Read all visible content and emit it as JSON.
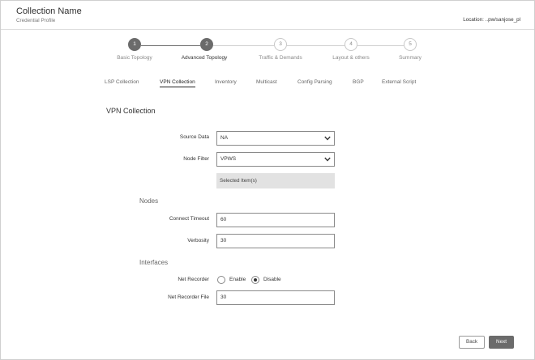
{
  "header": {
    "title": "Collection Name",
    "subtitle": "Credential Profile",
    "location": "Location: ..pw/sanjose_pl"
  },
  "steps": [
    {
      "number": "1",
      "label": "Basic Topology",
      "state": "done"
    },
    {
      "number": "2",
      "label": "Advanced Topology",
      "state": "active"
    },
    {
      "number": "3",
      "label": "Traffic & Demands",
      "state": "todo"
    },
    {
      "number": "4",
      "label": "Layout & others",
      "state": "todo"
    },
    {
      "number": "5",
      "label": "Summary",
      "state": "todo"
    }
  ],
  "tabs": [
    {
      "label": "LSP Collection",
      "active": false
    },
    {
      "label": "VPN Collection",
      "active": true
    },
    {
      "label": "Inventory",
      "active": false
    },
    {
      "label": "Multicast",
      "active": false
    },
    {
      "label": "Config Parsing",
      "active": false
    },
    {
      "label": "BGP",
      "active": false
    },
    {
      "label": "External Script",
      "active": false
    }
  ],
  "form": {
    "section_title": "VPN Collection",
    "source_data": {
      "label": "Source Data",
      "value": "NA"
    },
    "node_filter": {
      "label": "Node Filter",
      "value": "VPWS"
    },
    "selected_items": "Selected Item(s)",
    "nodes_title": "Nodes",
    "connect_timeout": {
      "label": "Connect Timeout",
      "value": "60"
    },
    "verbosity": {
      "label": "Verbosity",
      "value": "30"
    },
    "interfaces_title": "Interfaces",
    "net_recorder": {
      "label": "Net Recorder",
      "options": [
        "Enable",
        "Disable"
      ],
      "selected": "Disable"
    },
    "net_recorder_file": {
      "label": "Net Recorder File",
      "value": "30"
    }
  },
  "footer": {
    "back_label": "Back",
    "next_label": "Next"
  },
  "colors": {
    "step_done": "#6b6b6b",
    "border": "#cfcfcf",
    "selected_box": "#e2e2e2"
  }
}
